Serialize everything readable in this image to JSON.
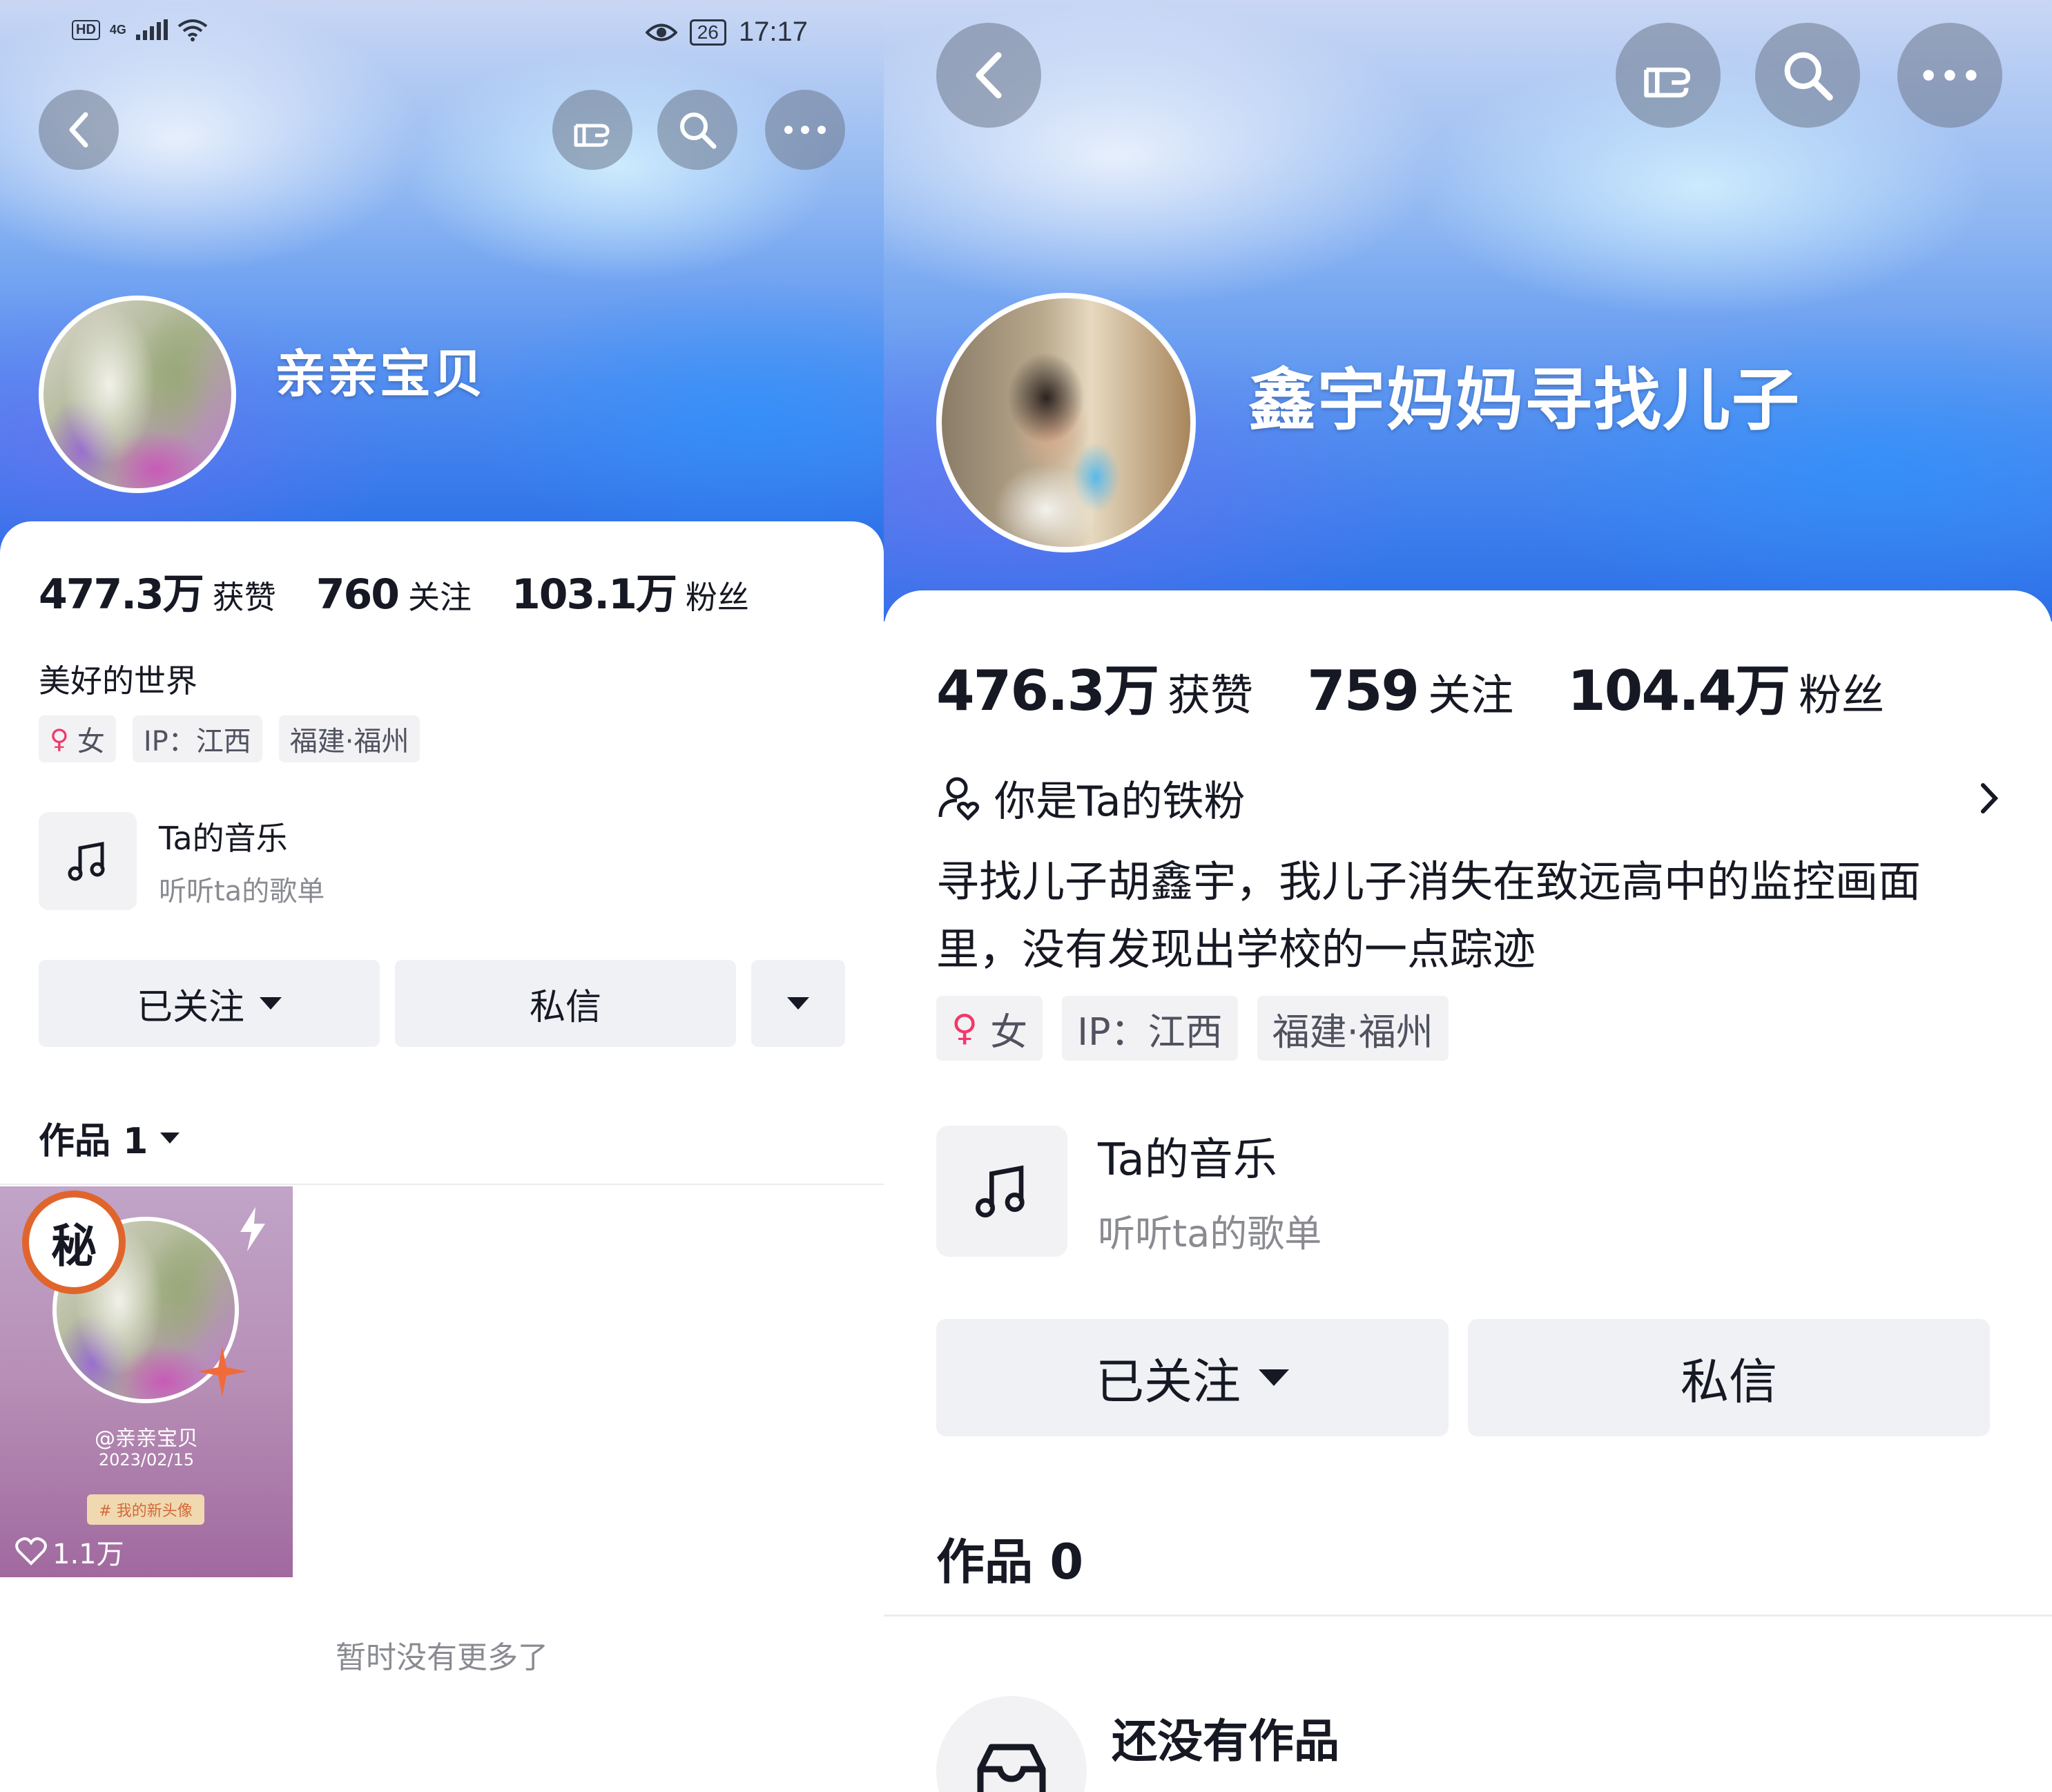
{
  "left": {
    "status": {
      "network": "4G",
      "hd": "HD",
      "battery": "26",
      "time": "17:17"
    },
    "profile": {
      "name": "亲亲宝贝"
    },
    "stats": [
      {
        "num": "477.3万",
        "label": "获赞"
      },
      {
        "num": "760",
        "label": "关注"
      },
      {
        "num": "103.1万",
        "label": "粉丝"
      }
    ],
    "bio": "美好的世界",
    "tags": {
      "gender": "女",
      "ip": "IP：江西",
      "location": "福建·福州"
    },
    "music": {
      "title": "Ta的音乐",
      "subtitle": "听听ta的歌单"
    },
    "buttons": {
      "follow": "已关注",
      "message": "私信"
    },
    "works": {
      "label": "作品 1"
    },
    "video": {
      "badge": "秘",
      "author": "@亲亲宝贝",
      "date": "2023/02/15",
      "hashtag": "# 我的新头像",
      "likes": "1.1万"
    },
    "footer": "暂时没有更多了"
  },
  "right": {
    "profile": {
      "name": "鑫宇妈妈寻找儿子"
    },
    "stats": [
      {
        "num": "476.3万",
        "label": "获赞"
      },
      {
        "num": "759",
        "label": "关注"
      },
      {
        "num": "104.4万",
        "label": "粉丝"
      }
    ],
    "fan": {
      "label": "你是Ta的铁粉"
    },
    "bio": [
      "寻找儿子胡鑫宇，我儿子消失在致远高中的监控画面",
      "里，没有发现出学校的一点踪迹"
    ],
    "tags": {
      "gender": "女",
      "ip": "IP：江西",
      "location": "福建·福州"
    },
    "music": {
      "title": "Ta的音乐",
      "subtitle": "听听ta的歌单"
    },
    "buttons": {
      "follow": "已关注",
      "message": "私信"
    },
    "works": {
      "label": "作品 0"
    },
    "empty": {
      "title": "还没有作品"
    }
  }
}
